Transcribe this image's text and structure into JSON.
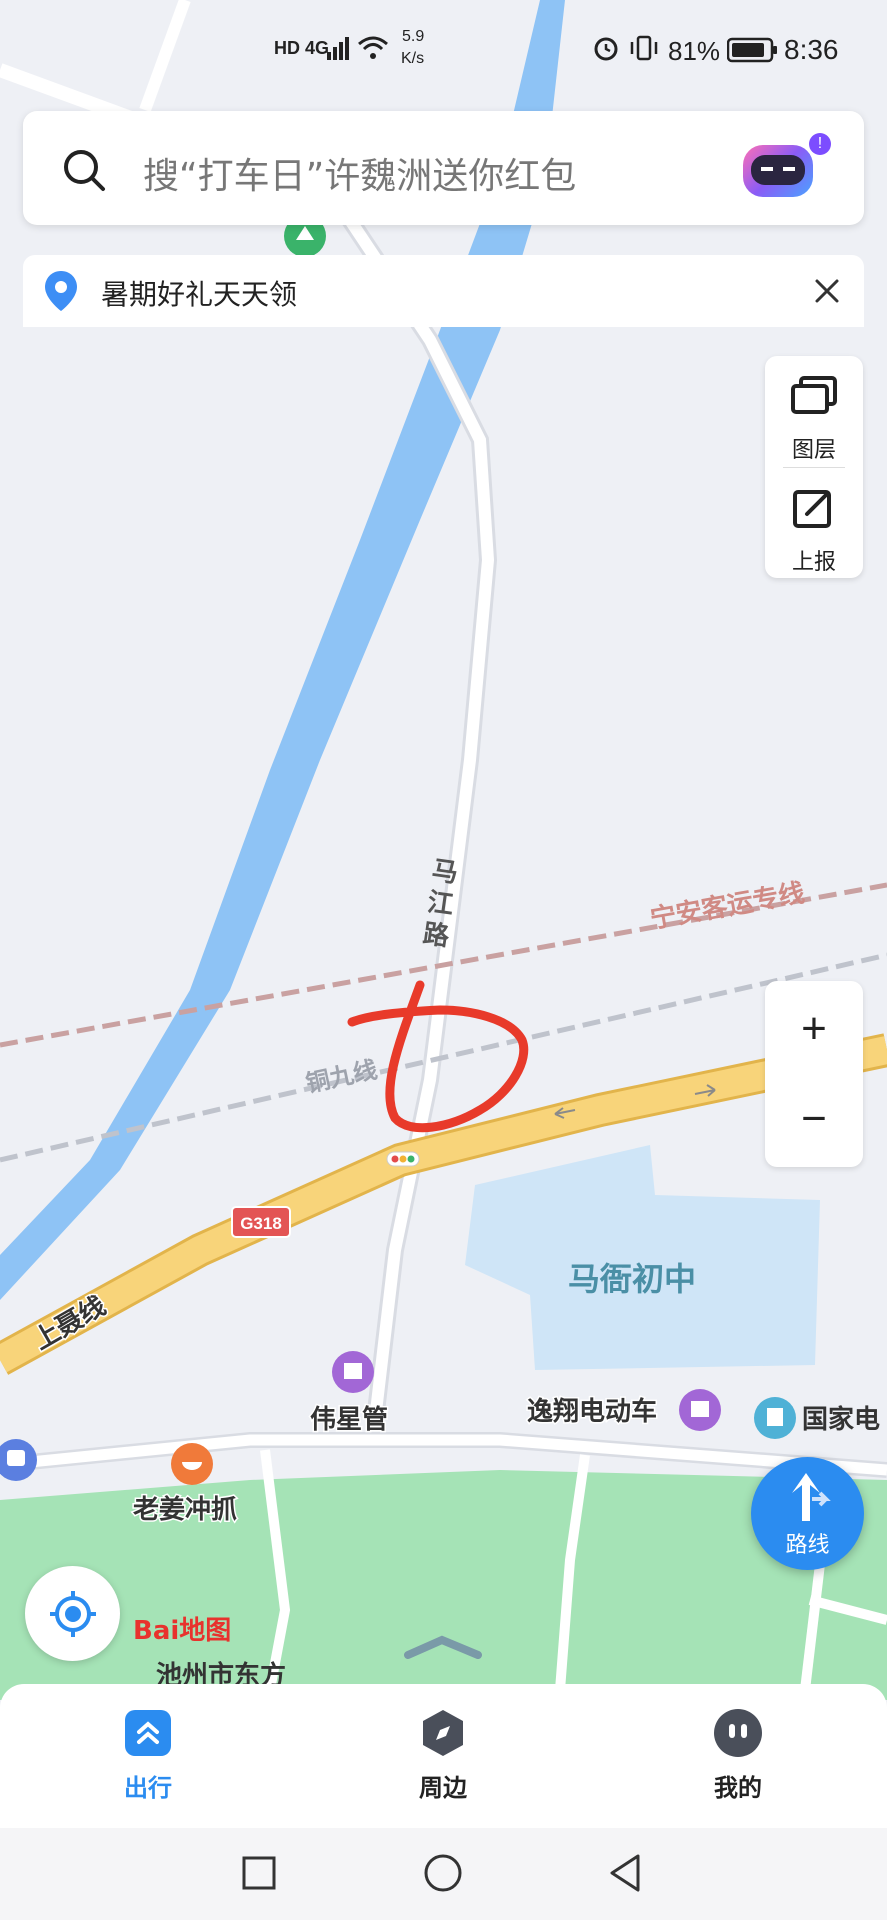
{
  "status_bar": {
    "network_tags": "HD 4G",
    "speed_value": "5.9",
    "speed_unit": "K/s",
    "battery": "81%",
    "time": "8:36"
  },
  "search": {
    "placeholder": "搜“打车日”许魏洲送你红包"
  },
  "banner": {
    "text": "暑期好礼天天领"
  },
  "side_tools": {
    "layers_label": "图层",
    "report_label": "上报"
  },
  "zoom": {
    "plus": "+",
    "minus": "−"
  },
  "route_button": {
    "label": "路线"
  },
  "map_labels": {
    "majiang_road": [
      "马",
      "江",
      "路"
    ],
    "railway_ningan": "宁安客运专线",
    "railway_tongjiu": "铜九线",
    "highway_shield": "G318",
    "shangnie_line": "上聂线",
    "school": "马衙初中",
    "poi_weixingguan": "伟星管",
    "poi_yixiang": "逸翔电动车",
    "poi_guojia": "国家电",
    "poi_laojiang": "老姜冲抓",
    "poi_chizhou": "池州市东方",
    "baidu_logo": "Bai地图"
  },
  "tabs": [
    {
      "label": "出行",
      "active": true
    },
    {
      "label": "周边",
      "active": false
    },
    {
      "label": "我的",
      "active": false
    }
  ],
  "colors": {
    "accent": "#2b8cf0",
    "river": "#8ec3f5",
    "park": "#a5e3b6",
    "highway": "#f8d47a",
    "annotation": "#e83a2a"
  }
}
